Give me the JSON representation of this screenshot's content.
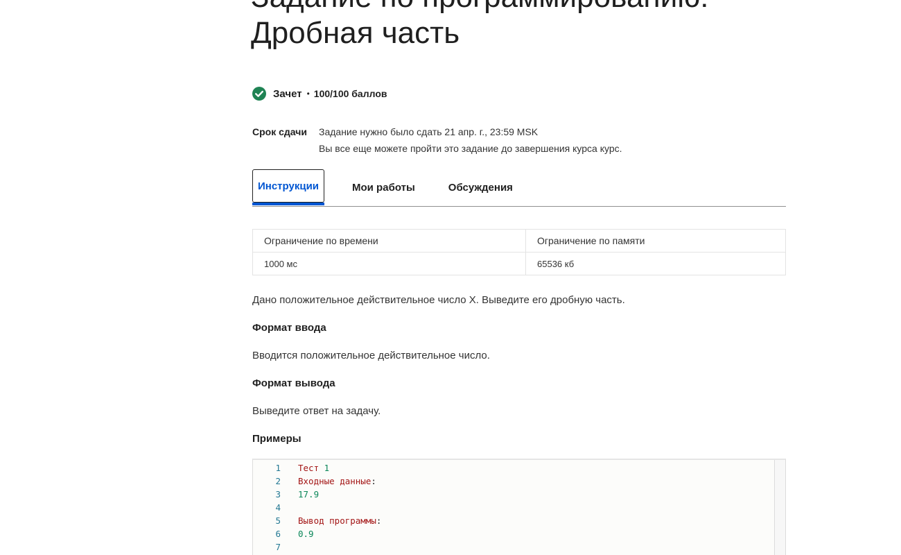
{
  "title": "Задание по программированию: Дробная часть",
  "status": {
    "label": "Зачет",
    "separator": "•",
    "score": "100/100 баллов",
    "icon": "check-circle-icon",
    "icon_color": "#1f8354"
  },
  "deadline": {
    "label": "Срок сдачи",
    "line1": "Задание нужно было сдать 21 апр. г., 23:59 MSK",
    "line2": "Вы все еще можете пройти это задание до завершения курса курс."
  },
  "tabs": [
    {
      "label": "Инструкции",
      "active": true
    },
    {
      "label": "Мои работы",
      "active": false
    },
    {
      "label": "Обсуждения",
      "active": false
    }
  ],
  "limits": {
    "headers": [
      "Ограничение по времени",
      "Ограничение по памяти"
    ],
    "values": [
      "1000 мс",
      "65536 кб"
    ]
  },
  "statement": {
    "description": "Дано положительное действительное число X. Выведите его дробную часть.",
    "input_heading": "Формат ввода",
    "input_text": "Вводится положительное действительное число.",
    "output_heading": "Формат вывода",
    "output_text": "Выведите ответ на задачу.",
    "examples_heading": "Примеры"
  },
  "code": {
    "lines": [
      {
        "n": "1",
        "a": "Тест",
        "b": " 1",
        "c": ""
      },
      {
        "n": "2",
        "a": "Входные данные",
        "b": "",
        "c": ":"
      },
      {
        "n": "3",
        "a": "",
        "b": "17.9",
        "c": ""
      },
      {
        "n": "4",
        "a": "",
        "b": "",
        "c": ""
      },
      {
        "n": "5",
        "a": "Вывод программы",
        "b": "",
        "c": ":"
      },
      {
        "n": "6",
        "a": "",
        "b": "0.9",
        "c": ""
      },
      {
        "n": "7",
        "a": "",
        "b": "",
        "c": ""
      }
    ]
  },
  "colors": {
    "accent": "#0056d2",
    "keyword": "#a31515",
    "number": "#098658",
    "line_number": "#237893"
  }
}
